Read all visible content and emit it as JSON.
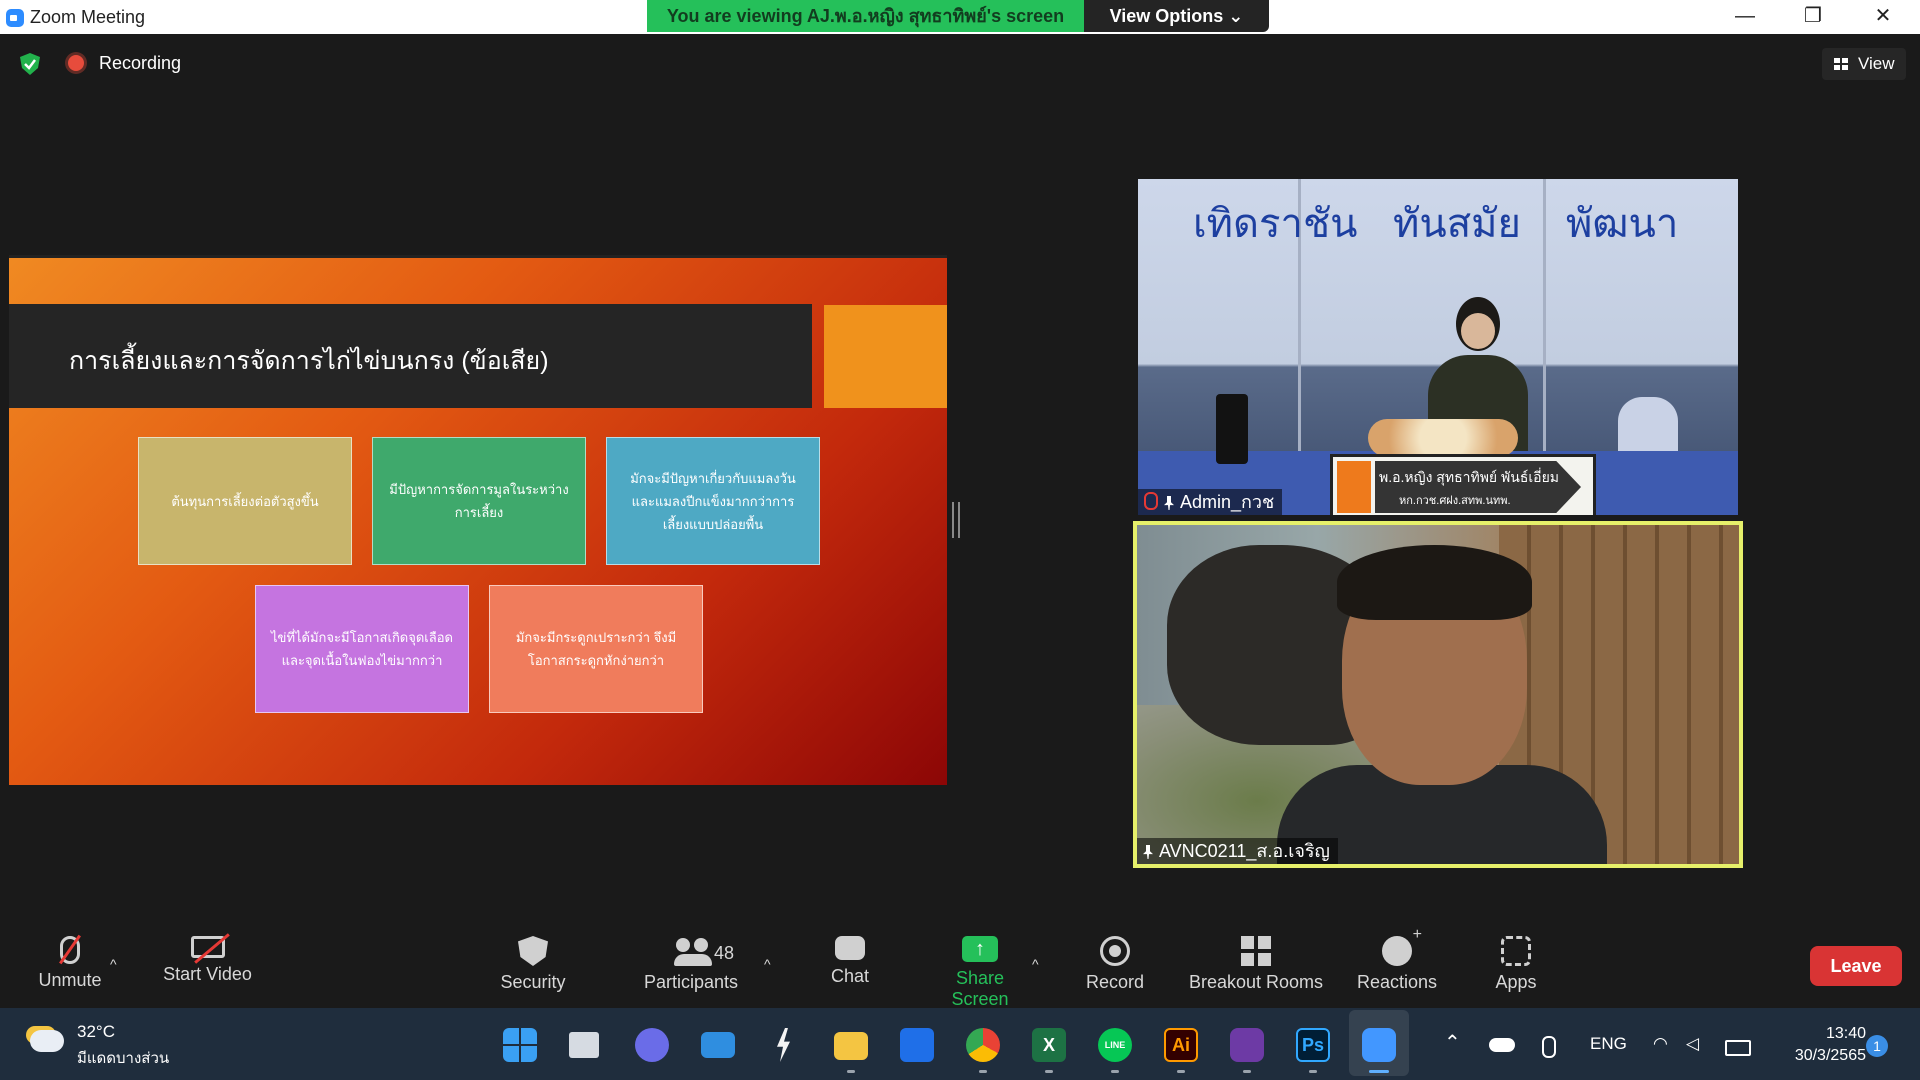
{
  "window": {
    "title": "Zoom Meeting",
    "banner": "You are viewing AJ.พ.อ.หญิง สุทธาทิพย์'s screen",
    "view_options": "View Options ⌄",
    "controls": [
      "—",
      "❐",
      "✕"
    ]
  },
  "meeting": {
    "recording_label": "Recording",
    "view_label": "View"
  },
  "slide": {
    "title": "การเลี้ยงและการจัดการไก่ไข่บนกรง (ข้อเสีย)",
    "boxes": [
      {
        "text": "ต้นทุนการเลี้ยงต่อตัวสูงขึ้น",
        "color": "#c8b56c"
      },
      {
        "text": "มีปัญหาการจัดการมูลในระหว่างการเลี้ยง",
        "color": "#3fa96c"
      },
      {
        "text": "มักจะมีปัญหาเกี่ยวกับแมลงวันและแมลงปีกแข็งมากกว่าการเลี้ยงแบบปล่อยพื้น",
        "color": "#4ea9c4"
      },
      {
        "text": "ไข่ที่ได้มักจะมีโอกาสเกิดจุดเลือดและจุดเนื้อในฟองไข่มากกว่า",
        "color": "#c574e0"
      },
      {
        "text": "มักจะมีกระดูกเปราะกว่า จึงมีโอกาสกระดูกหักง่ายกว่า",
        "color": "#f07c5c"
      }
    ]
  },
  "videos": [
    {
      "name": "Admin_กวช",
      "motto": [
        "เทิดราชัน",
        "ทันสมัย",
        "พัฒนา"
      ],
      "nameplate": {
        "line1": "พ.อ.หญิง สุทธาทิพย์ พันธ์เอี่ยม",
        "line2": "หก.กวช.ศฝง.สทพ.นทพ."
      }
    },
    {
      "name": "AVNC0211_ส.อ.เจริญ",
      "active_speaker_color": "#e6f06a"
    }
  ],
  "toolbar": {
    "unmute": "Unmute",
    "start_video": "Start Video",
    "security": "Security",
    "participants": "Participants",
    "participant_count": "48",
    "chat": "Chat",
    "share_screen": "Share Screen",
    "record": "Record",
    "breakout_rooms": "Breakout Rooms",
    "reactions": "Reactions",
    "apps": "Apps",
    "leave": "Leave",
    "caret": "^"
  },
  "taskbar": {
    "temperature": "32°C",
    "condition": "มีแดดบางส่วน",
    "apps": [
      "windows-start",
      "task-view",
      "teams-chat",
      "mail",
      "bolt",
      "file-explorer",
      "dropbox",
      "chrome",
      "excel",
      "line",
      "illustrator",
      "pdf",
      "photoshop",
      "zoom"
    ],
    "illustrator_label": "Ai",
    "photoshop_label": "Ps",
    "excel_label": "X",
    "line_label": "LINE",
    "language": "ENG",
    "time": "13:40",
    "date": "30/3/2565",
    "notifications": "1"
  },
  "colors": {
    "zoom_blue": "#2d8cff",
    "share_green": "#25c05a",
    "leave_red": "#d93434",
    "taskbar": "#1f2d3d"
  }
}
